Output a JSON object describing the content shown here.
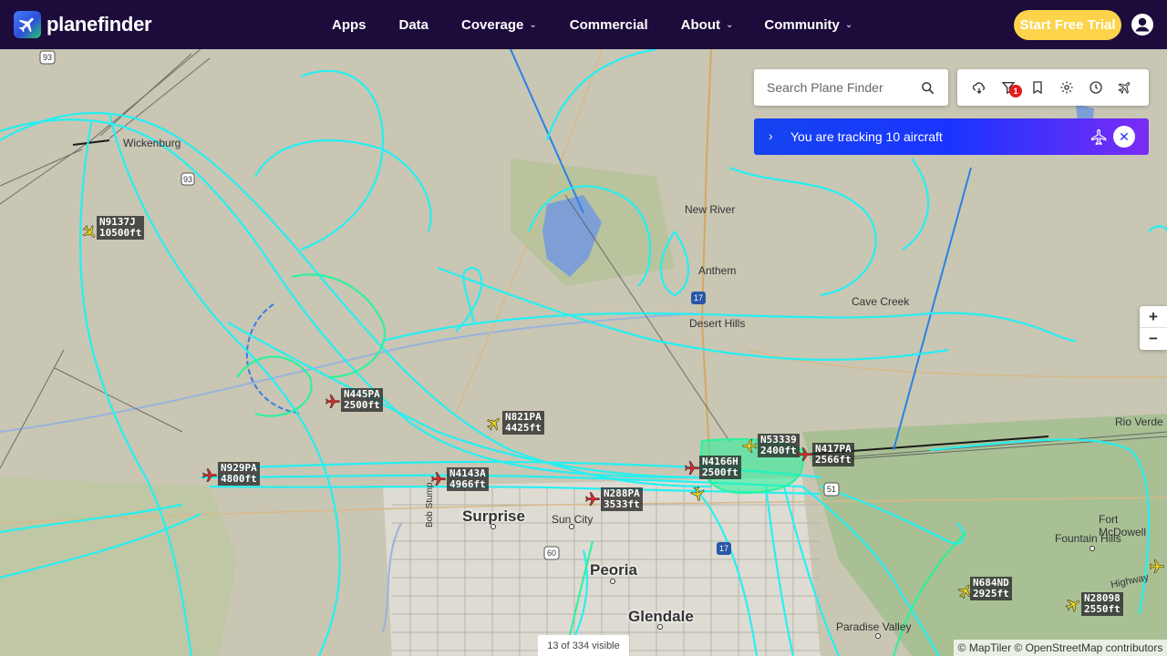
{
  "brand": {
    "name": "planefinder"
  },
  "nav": {
    "items": [
      {
        "label": "Apps",
        "dropdown": false
      },
      {
        "label": "Data",
        "dropdown": false
      },
      {
        "label": "Coverage",
        "dropdown": true
      },
      {
        "label": "Commercial",
        "dropdown": false
      },
      {
        "label": "About",
        "dropdown": true
      },
      {
        "label": "Community",
        "dropdown": true
      }
    ],
    "cta_label": "Start Free Trial"
  },
  "search": {
    "placeholder": "Search Plane Finder"
  },
  "toolbar": {
    "icons": [
      "weather-icon",
      "filter-icon",
      "bookmark-icon",
      "settings-icon",
      "history-icon",
      "playback-icon"
    ],
    "filter_badge": "1"
  },
  "tracking": {
    "text": "You are tracking 10 aircraft"
  },
  "zoom": {
    "in": "+",
    "out": "−"
  },
  "status": {
    "visible": "13 of 334 visible"
  },
  "attribution": "© MapTiler © OpenStreetMap contributors",
  "places": [
    {
      "name": "Wickenburg",
      "big": false
    },
    {
      "name": "New River",
      "big": false
    },
    {
      "name": "Anthem",
      "big": false
    },
    {
      "name": "Cave Creek",
      "big": false
    },
    {
      "name": "Desert Hills",
      "big": false
    },
    {
      "name": "Surprise",
      "big": true
    },
    {
      "name": "Sun City",
      "big": false
    },
    {
      "name": "Peoria",
      "big": true
    },
    {
      "name": "Glendale",
      "big": true
    },
    {
      "name": "Fountain Hills",
      "big": false
    },
    {
      "name": "Paradise Valley",
      "big": false
    },
    {
      "name": "Fort McDowell",
      "big": false
    },
    {
      "name": "Rio Verde",
      "big": false
    },
    {
      "name": "Bob Stump",
      "big": false
    },
    {
      "name": "Highway",
      "big": false
    }
  ],
  "road_shields": [
    "93",
    "60",
    "17",
    "17",
    "51",
    "93"
  ],
  "aircraft": [
    {
      "callsign": "N9137J",
      "altitude": "10500ft",
      "color": "#e8d21a"
    },
    {
      "callsign": "N445PA",
      "altitude": "2500ft",
      "color": "#d82a2a"
    },
    {
      "callsign": "N821PA",
      "altitude": "4425ft",
      "color": "#e8d21a"
    },
    {
      "callsign": "N929PA",
      "altitude": "4800ft",
      "color": "#d82a2a"
    },
    {
      "callsign": "N4143A",
      "altitude": "4966ft",
      "color": "#d82a2a"
    },
    {
      "callsign": "N288PA",
      "altitude": "3533ft",
      "color": "#d82a2a"
    },
    {
      "callsign": "N4166H",
      "altitude": "2500ft",
      "color": "#d82a2a"
    },
    {
      "callsign": "N53339",
      "altitude": "2400ft",
      "color": "#e8d21a"
    },
    {
      "callsign": "N417PA",
      "altitude": "2566ft",
      "color": "#d82a2a"
    },
    {
      "callsign": "N684ND",
      "altitude": "2925ft",
      "color": "#e8d21a"
    },
    {
      "callsign": "N28098",
      "altitude": "2550ft",
      "color": "#e8d21a"
    }
  ],
  "colors": {
    "header_bg": "#1c0b3b",
    "cta_bg": "#fbd44b",
    "track": "#1ef2f5",
    "track_selected": "#21f59a",
    "tracking_gradient_start": "#1544f0",
    "tracking_gradient_end": "#7a2cf5"
  }
}
